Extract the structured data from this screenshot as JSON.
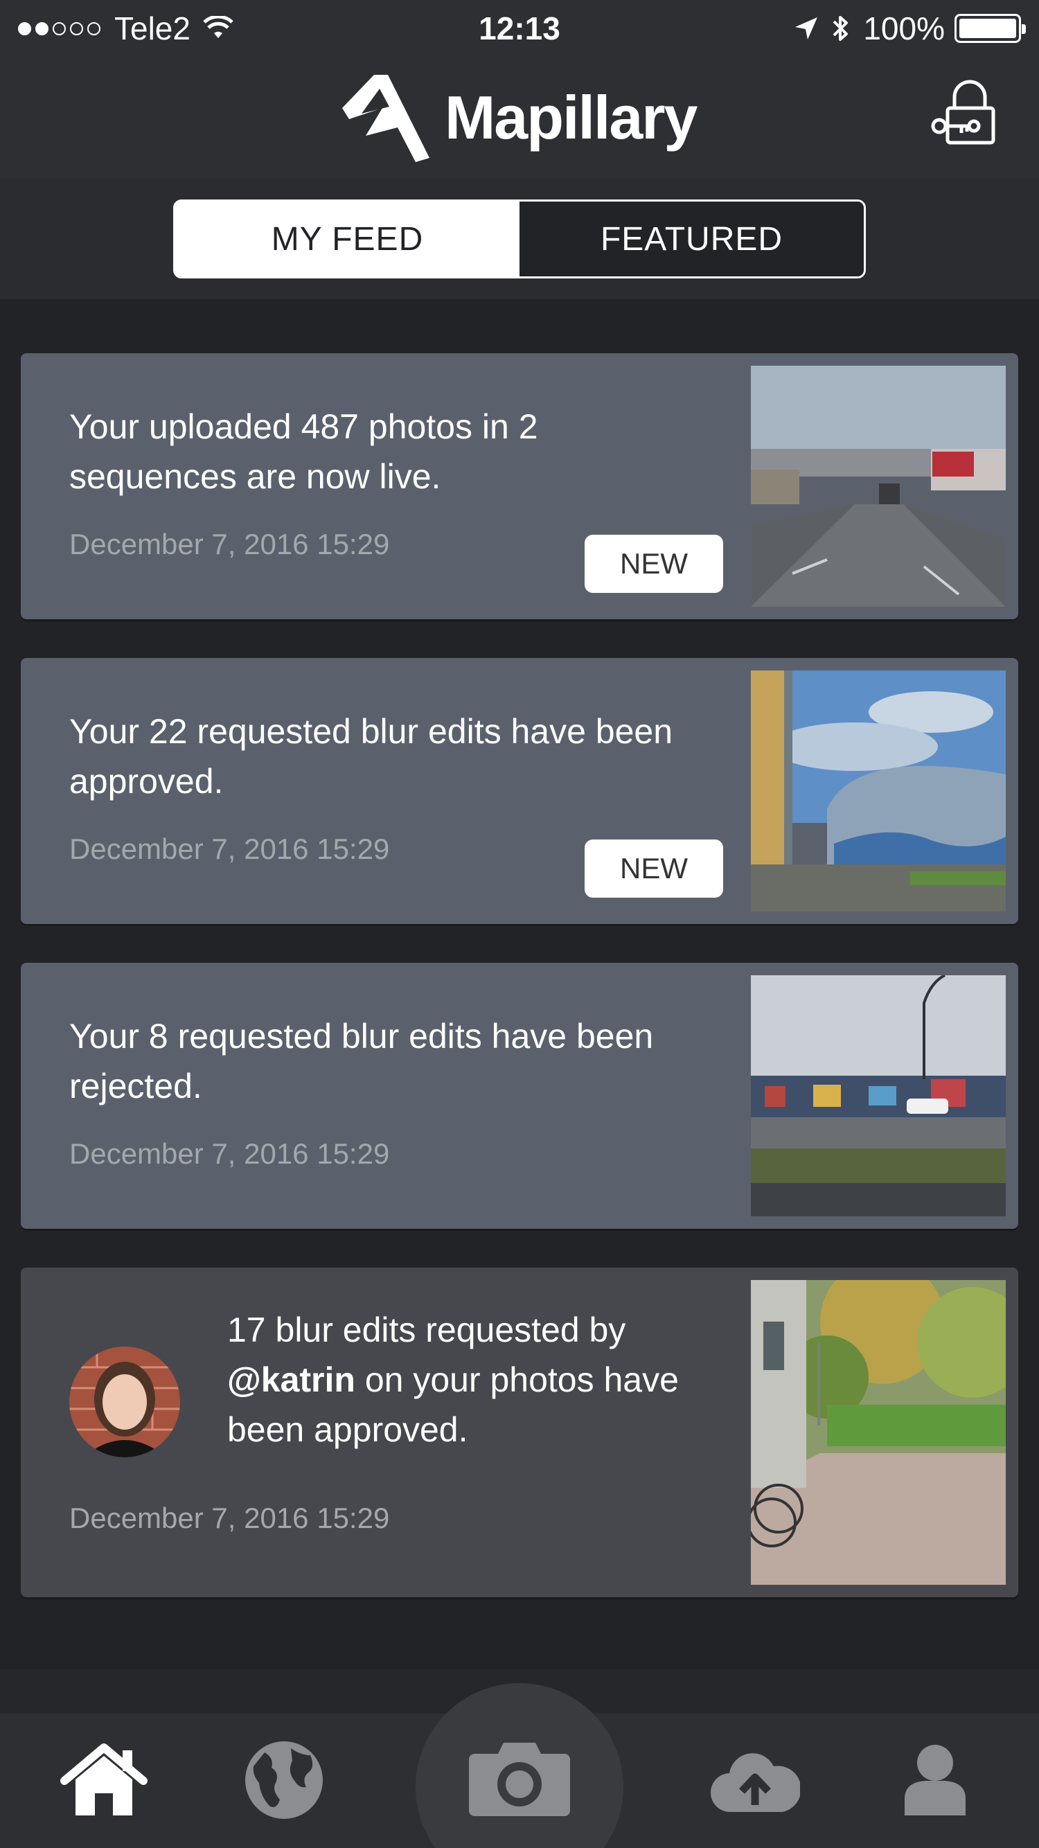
{
  "status_bar": {
    "carrier": "Tele2",
    "time": "12:13",
    "battery": "100%",
    "signal_bars_filled": 2,
    "signal_bars_total": 5
  },
  "header": {
    "brand": "Mapillary",
    "brand_icon": "mapillary-logo-icon",
    "login_icon": "lock-key-icon"
  },
  "tabs": {
    "my_feed": "MY FEED",
    "featured": "FEATURED",
    "selected": "MY FEED"
  },
  "feed": {
    "items": [
      {
        "text": "Your uploaded 487 photos in 2 sequences are now live.",
        "date": "December 7, 2016 15:29",
        "badge": "NEW"
      },
      {
        "text": "Your 22 requested blur edits have been approved.",
        "date": "December 7, 2016 15:29",
        "badge": "NEW"
      },
      {
        "text": "Your 8 requested blur edits have been rejected.",
        "date": "December 7, 2016 15:29"
      },
      {
        "text_before": "17 blur edits requested by ",
        "mention": "@katrin",
        "text_after": " on your photos have been approved.",
        "date": "December 7, 2016 15:29"
      }
    ]
  },
  "bottom_bar": {
    "items": [
      "home-icon",
      "globe-icon",
      "camera-icon",
      "upload-cloud-icon",
      "user-icon"
    ]
  },
  "colors": {
    "background": "#222326",
    "header": "#2e2f33",
    "card": "#5b616c",
    "card_dark": "#46484e",
    "date": "#a4a8ae",
    "accent": "#ffffff"
  }
}
